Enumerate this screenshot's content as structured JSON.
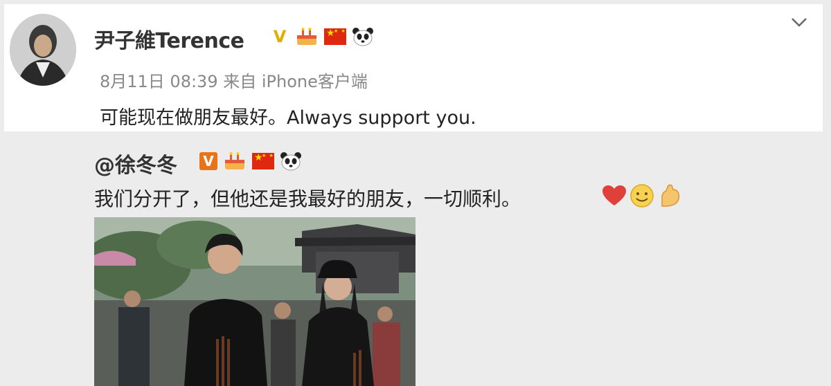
{
  "post": {
    "username": "尹子維Terence",
    "meta": "8月11日 08:39 来自 iPhone客户端",
    "text": "可能现在做朋友最好。Always support you."
  },
  "repost": {
    "username": "@徐冬冬",
    "text": "我们分开了，但他还是我最好的朋友，一切顺利。"
  },
  "icons": {
    "verified_gold": "V",
    "verified_orange": "V",
    "chevron": "chevron-down-icon",
    "emojis": [
      "heart-icon",
      "smile-icon",
      "strong-arm-icon"
    ]
  },
  "colors": {
    "verified_gold": "#e0b000",
    "verified_orange": "#e8741a",
    "flag_red": "#de2910",
    "heart": "#e0403a"
  }
}
